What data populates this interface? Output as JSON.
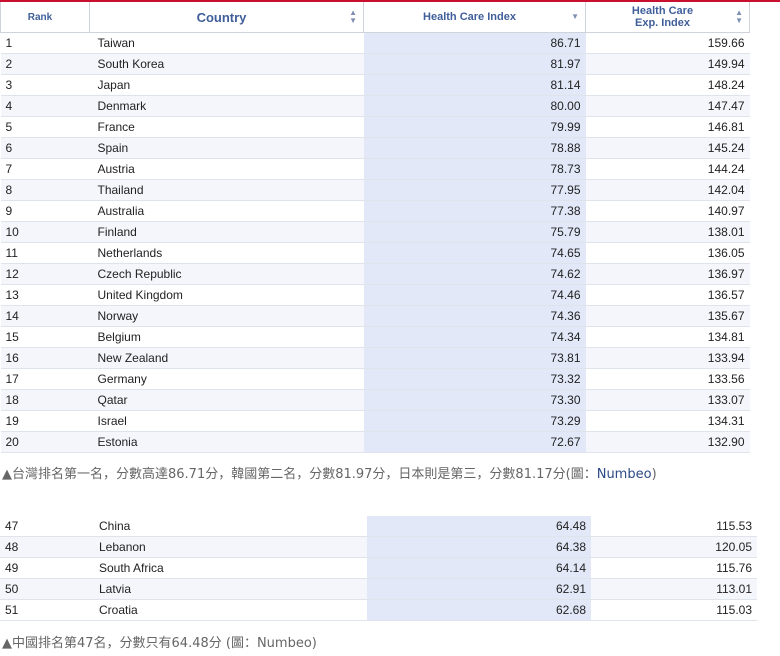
{
  "headers": {
    "rank": "Rank",
    "country": "Country",
    "hci": "Health Care Index",
    "hce_line1": "Health Care",
    "hce_line2": "Exp. Index"
  },
  "top_rows": [
    {
      "rank": "1",
      "country": "Taiwan",
      "hci": "86.71",
      "hce": "159.66"
    },
    {
      "rank": "2",
      "country": "South Korea",
      "hci": "81.97",
      "hce": "149.94"
    },
    {
      "rank": "3",
      "country": "Japan",
      "hci": "81.14",
      "hce": "148.24"
    },
    {
      "rank": "4",
      "country": "Denmark",
      "hci": "80.00",
      "hce": "147.47"
    },
    {
      "rank": "5",
      "country": "France",
      "hci": "79.99",
      "hce": "146.81"
    },
    {
      "rank": "6",
      "country": "Spain",
      "hci": "78.88",
      "hce": "145.24"
    },
    {
      "rank": "7",
      "country": "Austria",
      "hci": "78.73",
      "hce": "144.24"
    },
    {
      "rank": "8",
      "country": "Thailand",
      "hci": "77.95",
      "hce": "142.04"
    },
    {
      "rank": "9",
      "country": "Australia",
      "hci": "77.38",
      "hce": "140.97"
    },
    {
      "rank": "10",
      "country": "Finland",
      "hci": "75.79",
      "hce": "138.01"
    },
    {
      "rank": "11",
      "country": "Netherlands",
      "hci": "74.65",
      "hce": "136.05"
    },
    {
      "rank": "12",
      "country": "Czech Republic",
      "hci": "74.62",
      "hce": "136.97"
    },
    {
      "rank": "13",
      "country": "United Kingdom",
      "hci": "74.46",
      "hce": "136.57"
    },
    {
      "rank": "14",
      "country": "Norway",
      "hci": "74.36",
      "hce": "135.67"
    },
    {
      "rank": "15",
      "country": "Belgium",
      "hci": "74.34",
      "hce": "134.81"
    },
    {
      "rank": "16",
      "country": "New Zealand",
      "hci": "73.81",
      "hce": "133.94"
    },
    {
      "rank": "17",
      "country": "Germany",
      "hci": "73.32",
      "hce": "133.56"
    },
    {
      "rank": "18",
      "country": "Qatar",
      "hci": "73.30",
      "hce": "133.07"
    },
    {
      "rank": "19",
      "country": "Israel",
      "hci": "73.29",
      "hce": "134.31"
    },
    {
      "rank": "20",
      "country": "Estonia",
      "hci": "72.67",
      "hce": "132.90"
    }
  ],
  "bottom_rows": [
    {
      "rank": "47",
      "country": "China",
      "hci": "64.48",
      "hce": "115.53"
    },
    {
      "rank": "48",
      "country": "Lebanon",
      "hci": "64.38",
      "hce": "120.05"
    },
    {
      "rank": "49",
      "country": "South Africa",
      "hci": "64.14",
      "hce": "115.76"
    },
    {
      "rank": "50",
      "country": "Latvia",
      "hci": "62.91",
      "hce": "113.01"
    },
    {
      "rank": "51",
      "country": "Croatia",
      "hci": "62.68",
      "hce": "115.03"
    }
  ],
  "captions": {
    "top_text": "▲台灣排名第一名，分數高達86.71分，韓國第二名，分數81.97分，日本則是第三，分數81.17分(圖：",
    "top_source": "Numbeo",
    "top_end": ")",
    "bottom_text": "▲中國排名第47名，分數只有64.48分 (圖：Numbeo)"
  },
  "colors": {
    "accent_red": "#c8102e",
    "header_text": "#3f5e9a",
    "index_column_bg": "#e2e8f8",
    "caption_text": "#666666",
    "source_link": "#2c4a87"
  },
  "icons": {
    "sort_both": "sort-arrows-icon",
    "sort_desc": "sort-desc-icon"
  }
}
